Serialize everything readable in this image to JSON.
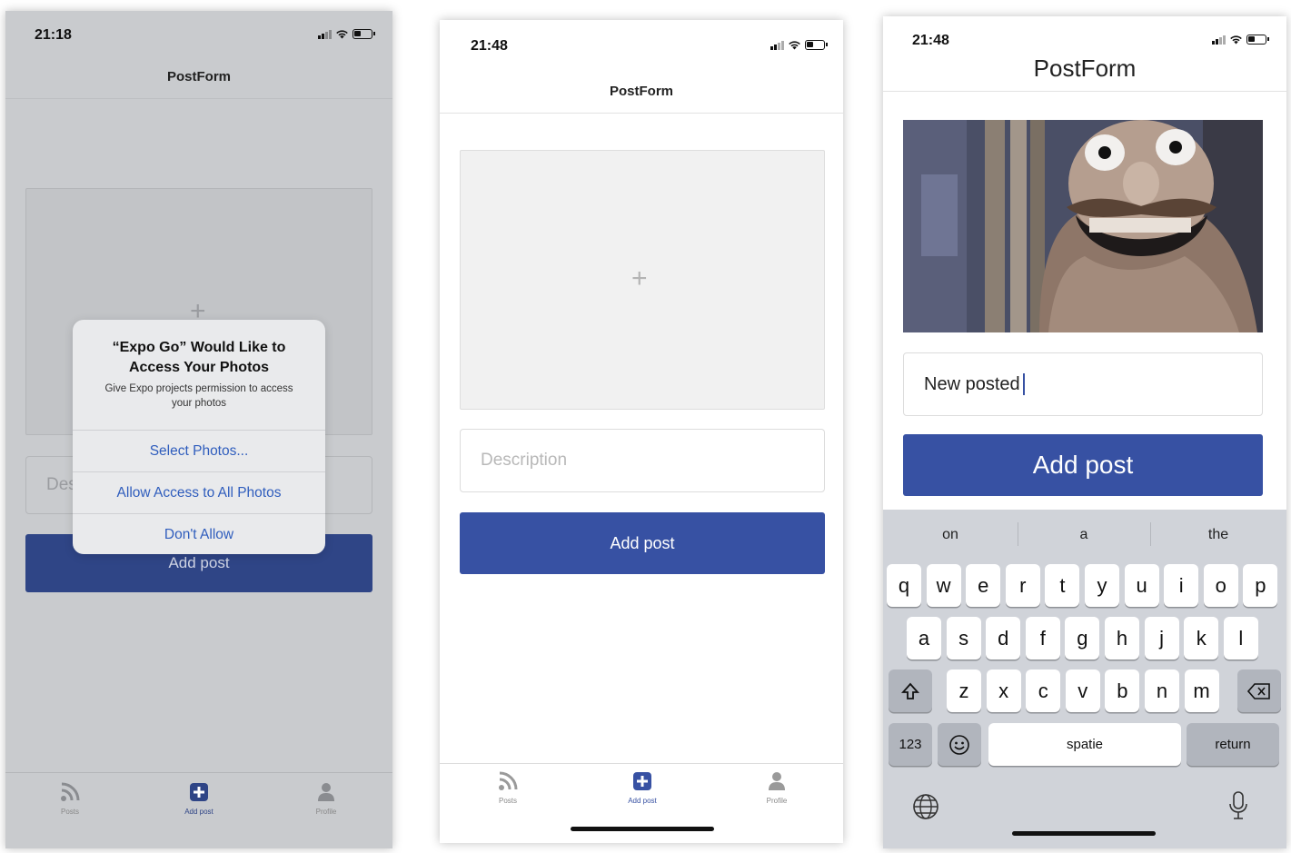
{
  "screens": [
    {
      "status_time": "21:18",
      "header_title": "PostForm",
      "description_placeholder": "Description",
      "add_button": "Add post",
      "dialog": {
        "title": "“Expo Go” Would Like to Access Your Photos",
        "message": "Give Expo projects permission to access your photos",
        "buttons": [
          "Select Photos...",
          "Allow Access to All Photos",
          "Don't Allow"
        ]
      },
      "tabs": [
        "Posts",
        "Add post",
        "Profile"
      ]
    },
    {
      "status_time": "21:48",
      "header_title": "PostForm",
      "description_placeholder": "Description",
      "add_button": "Add post",
      "tabs": [
        "Posts",
        "Add post",
        "Profile"
      ]
    },
    {
      "status_time": "21:48",
      "header_title": "PostForm",
      "description_value": "New posted",
      "add_button": "Add post",
      "keyboard": {
        "suggestions": [
          "on",
          "a",
          "the"
        ],
        "row1": [
          "q",
          "w",
          "e",
          "r",
          "t",
          "y",
          "u",
          "i",
          "o",
          "p"
        ],
        "row2": [
          "a",
          "s",
          "d",
          "f",
          "g",
          "h",
          "j",
          "k",
          "l"
        ],
        "row3": [
          "z",
          "x",
          "c",
          "v",
          "b",
          "n",
          "m"
        ],
        "numbers_key": "123",
        "space_key": "spatie",
        "return_key": "return"
      }
    }
  ],
  "colors": {
    "accent": "#3751a3",
    "dim_background": "#c9cbce",
    "keyboard_background": "#d0d3d9"
  },
  "icons": [
    "rss-icon",
    "plus-square-icon",
    "user-icon",
    "shift-icon",
    "backspace-icon",
    "emoji-icon",
    "globe-icon",
    "microphone-icon"
  ]
}
